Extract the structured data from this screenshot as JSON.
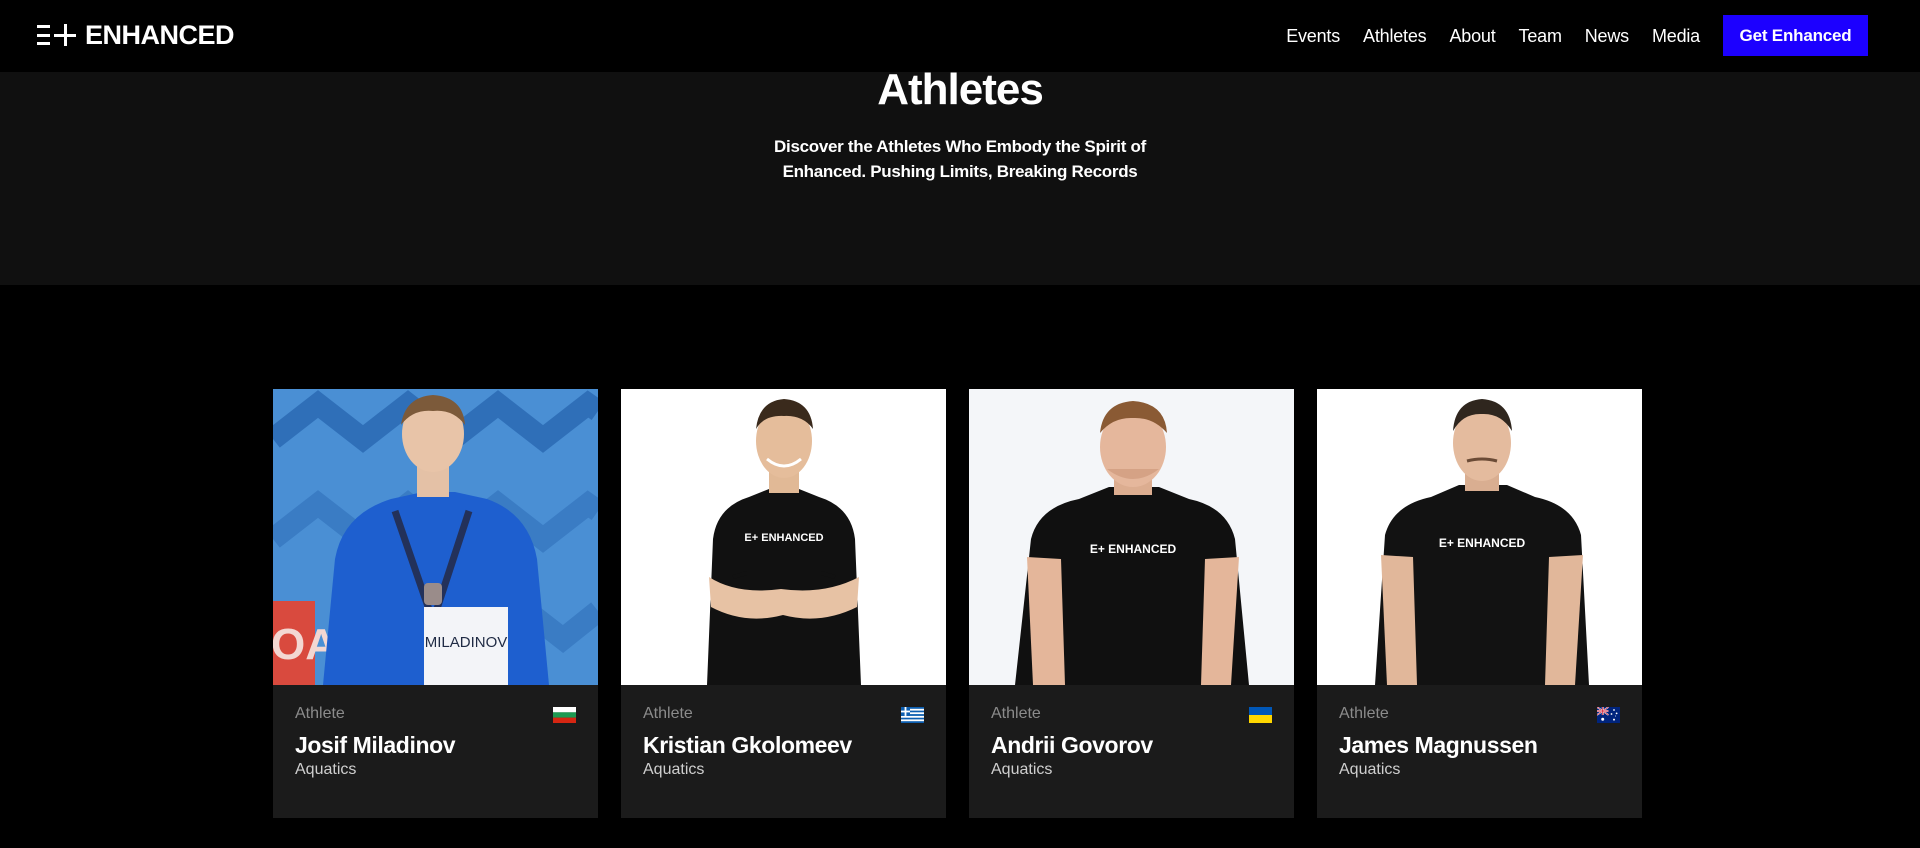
{
  "header": {
    "logo_text": "ENHANCED",
    "logo_mark": "E+",
    "nav": [
      "Events",
      "Athletes",
      "About",
      "Team",
      "News",
      "Media"
    ],
    "cta_label": "Get Enhanced"
  },
  "hero": {
    "title": "Athletes",
    "subtitle_line1": "Discover the Athletes Who Embody the Spirit of",
    "subtitle_line2": "Enhanced. Pushing Limits, Breaking Records"
  },
  "athletes": [
    {
      "role": "Athlete",
      "name": "Josif Miladinov",
      "sport": "Aquatics",
      "flag": "bulgaria-flag-icon",
      "bib": "MILADINOV"
    },
    {
      "role": "Athlete",
      "name": "Kristian Gkolomeev",
      "sport": "Aquatics",
      "flag": "greece-flag-icon",
      "shirt_text": "E+ ENHANCED"
    },
    {
      "role": "Athlete",
      "name": "Andrii Govorov",
      "sport": "Aquatics",
      "flag": "ukraine-flag-icon",
      "shirt_text": "E+ ENHANCED"
    },
    {
      "role": "Athlete",
      "name": "James Magnussen",
      "sport": "Aquatics",
      "flag": "australia-flag-icon",
      "shirt_text": "E+ ENHANCED"
    }
  ],
  "colors": {
    "cta": "#1c00ff",
    "page_bg": "#000000",
    "hero_bg": "#101010",
    "card_bg": "#1b1b1b",
    "muted_text": "#8b8b8b"
  }
}
